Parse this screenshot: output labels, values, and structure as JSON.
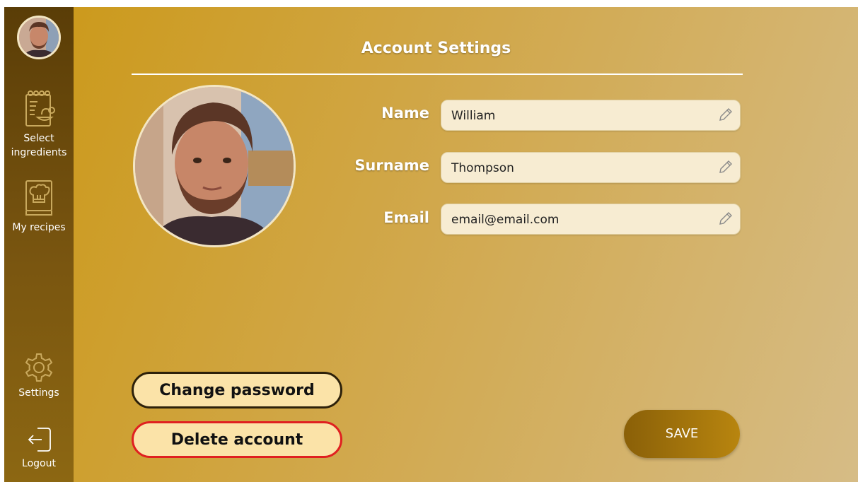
{
  "sidebar": {
    "items": [
      {
        "label": "Select\ningredients",
        "icon": "menu-recipe-icon"
      },
      {
        "label": "My recipes",
        "icon": "recipe-book-icon"
      },
      {
        "label": "Settings",
        "icon": "gear-icon"
      },
      {
        "label": "Logout",
        "icon": "logout-icon"
      }
    ]
  },
  "page": {
    "title": "Account Settings"
  },
  "form": {
    "name": {
      "label": "Name",
      "value": "William"
    },
    "surname": {
      "label": "Surname",
      "value": "Thompson"
    },
    "email": {
      "label": "Email",
      "value": "email@email.com"
    }
  },
  "actions": {
    "change_password": "Change password",
    "delete_account": "Delete account",
    "save": "SAVE"
  },
  "colors": {
    "sidebar": "#5a3d07",
    "accent": "#cc9a1d",
    "field_bg": "#f7ecd2",
    "button_bg": "#fbe3a8",
    "danger": "#e02020"
  }
}
